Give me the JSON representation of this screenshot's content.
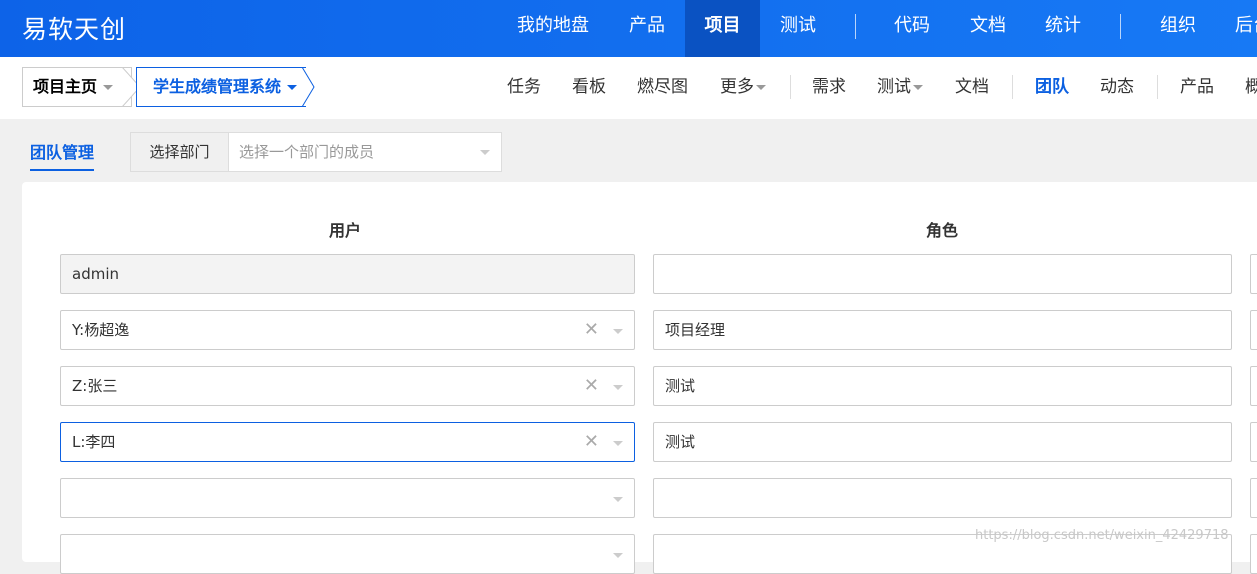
{
  "brand": "易软天创",
  "topnav": [
    {
      "label": "我的地盘"
    },
    {
      "label": "产品"
    },
    {
      "label": "项目",
      "active": true
    },
    {
      "label": "测试"
    },
    {
      "label": "代码"
    },
    {
      "label": "文档"
    },
    {
      "label": "统计"
    },
    {
      "label": "组织"
    },
    {
      "label": "后台"
    }
  ],
  "breadcrumb": {
    "home": "项目主页",
    "project": "学生成绩管理系统"
  },
  "subnav": [
    {
      "label": "任务"
    },
    {
      "label": "看板"
    },
    {
      "label": "燃尽图"
    },
    {
      "label": "更多"
    },
    {
      "label": "需求"
    },
    {
      "label": "测试"
    },
    {
      "label": "文档"
    },
    {
      "label": "团队",
      "active": true
    },
    {
      "label": "动态"
    },
    {
      "label": "产品"
    },
    {
      "label": "概况"
    }
  ],
  "toolbar": {
    "team_tab": "团队管理",
    "dept_label": "选择部门",
    "dept_placeholder": "选择一个部门的成员"
  },
  "table": {
    "headers": {
      "user": "用户",
      "role": "角色"
    },
    "rows": [
      {
        "user": "admin",
        "role": "",
        "user_state": "disabled"
      },
      {
        "user": "Y:杨超逸",
        "role": "项目经理",
        "user_state": "clearable"
      },
      {
        "user": "Z:张三",
        "role": "测试",
        "user_state": "clearable"
      },
      {
        "user": "L:李四",
        "role": "测试",
        "user_state": "focused"
      },
      {
        "user": "",
        "role": "",
        "user_state": "empty"
      },
      {
        "user": "",
        "role": "",
        "user_state": "empty"
      }
    ]
  },
  "watermark": "https://blog.csdn.net/weixin_42429718",
  "colors": {
    "topbar": "#1370ef",
    "accent": "#0c60e1",
    "active_top": "#0a52c2"
  }
}
